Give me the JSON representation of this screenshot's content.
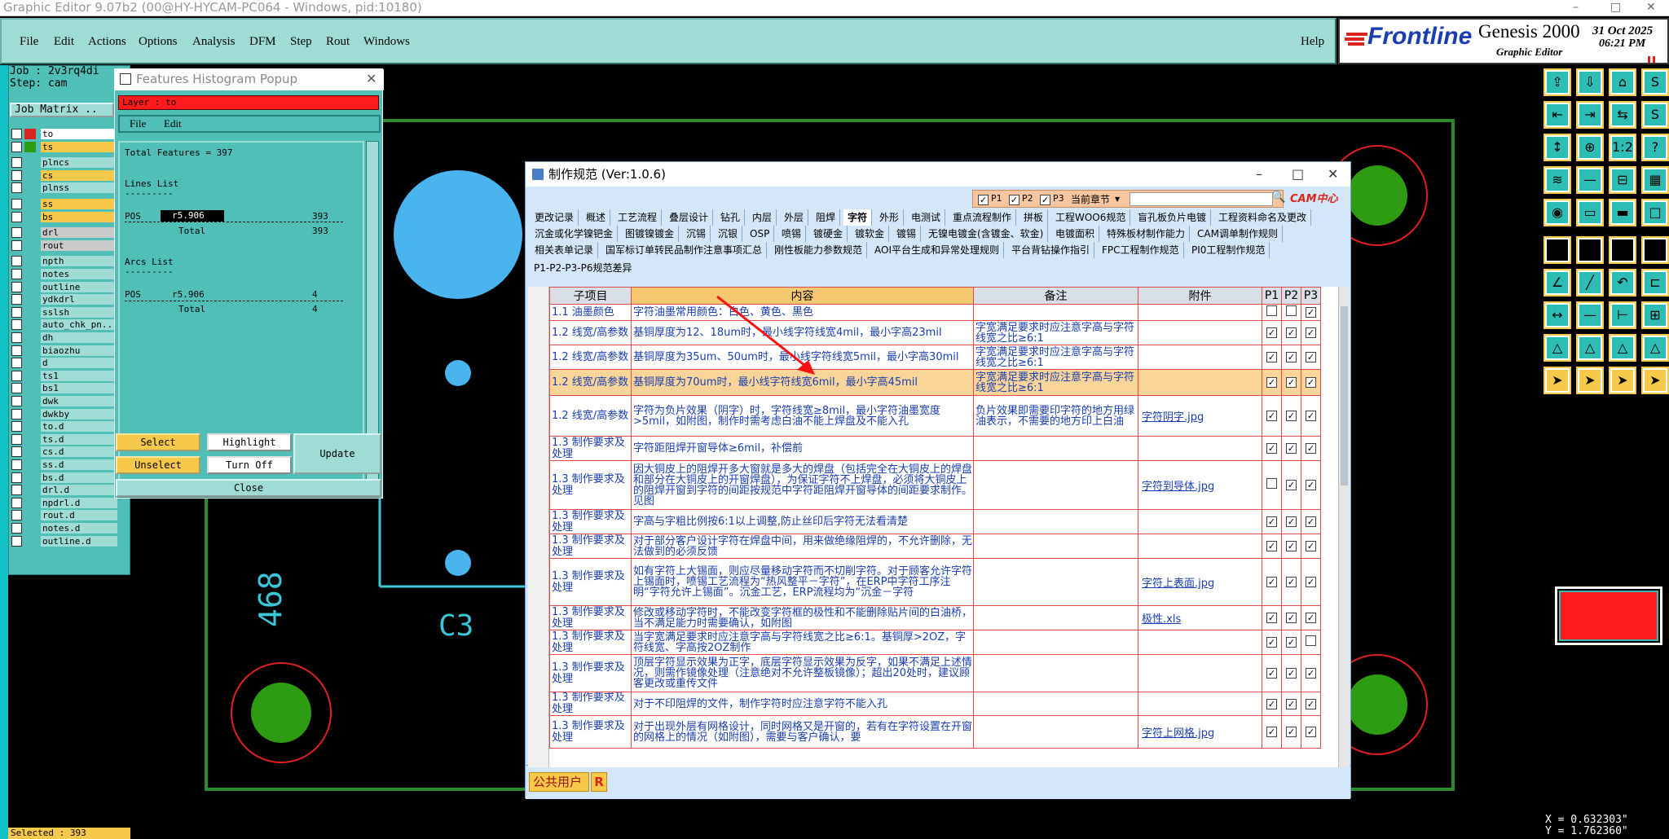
{
  "window": {
    "title": "Graphic Editor 9.07b2 (00@HY-HYCAM-PC064 - Windows, pid:10180)",
    "min": "–",
    "max": "□",
    "close": "✕"
  },
  "menu": {
    "file": "File",
    "edit": "Edit",
    "actions": "Actions",
    "options": "Options",
    "analysis": "Analysis",
    "dfm": "DFM",
    "step": "Step",
    "rout": "Rout",
    "windows": "Windows",
    "help": "Help"
  },
  "brand": {
    "logo": "Frontline",
    "product": "Genesis 2000",
    "subtitle": "Graphic Editor",
    "date": "31 Oct 2025",
    "time": "06:21 PM"
  },
  "job": {
    "job": "Job : 2v3rq4di",
    "step": "Step: cam",
    "matrix": "Job Matrix .."
  },
  "layers": [
    "to",
    "ts",
    "plncs",
    "cs",
    "plnss",
    "ss",
    "bs",
    "drl",
    "rout",
    "npth",
    "notes",
    "outline",
    "ydkdrl",
    "sslsh",
    "auto_chk_pn..",
    "dh",
    "biaozhu",
    "d",
    "ts1",
    "bs1",
    "dwk",
    "dwkby",
    "to.d",
    "ts.d",
    "cs.d",
    "ss.d",
    "bs.d",
    "drl.d",
    "npdrl.d",
    "rout.d",
    "notes.d",
    "outline.d"
  ],
  "selected": "Selected : 393",
  "histogram": {
    "title": "Features Histogram Popup",
    "layer": "Layer :  to",
    "file": "File",
    "edit": "Edit",
    "total": "Total Features = 397",
    "lines_title": "Lines List",
    "dash": "---------",
    "pos": "POS",
    "sym": "r5.906",
    "lines_count": "393",
    "total_lbl": "Total",
    "arcs_title": "Arcs List",
    "arcs_count": "4",
    "select": "Select",
    "highlight": "Highlight",
    "update": "Update",
    "unselect": "Unselect",
    "turnoff": "Turn Off",
    "close": "Close"
  },
  "board": {
    "label_c3": "C3",
    "label_468": "468"
  },
  "mk": {
    "title": "制作规范 (Ver:1.0.6)",
    "p1": "P1",
    "p2": "P2",
    "p3": "P3",
    "chapter": "当前章节",
    "logo": "CAM中心",
    "tabs_row1": [
      "更改记录",
      "概述",
      "工艺流程",
      "叠层设计",
      "钻孔",
      "内层",
      "外层",
      "阻焊",
      "字符",
      "外形",
      "电测试",
      "重点流程制作",
      "拼板",
      "工程WOO6规范",
      "盲孔板负片电镀",
      "工程资料命名及更改"
    ],
    "tabs_row2": [
      "沉金或化学镍钯金",
      "图镀镍镀金",
      "沉锡",
      "沉银",
      "OSP",
      "喷锡",
      "镀硬金",
      "镀软金",
      "镀锡",
      "无镍电镀金(含镀金、软金)",
      "电镀面积",
      "特殊板材制作能力",
      "CAM调单制作规则"
    ],
    "tabs_row3": [
      "相关表单记录",
      "国军标订单转民品制作注意事项汇总",
      "刚性板能力参数规范",
      "AOI平台生成和异常处理规则",
      "平台背钻操作指引",
      "FPC工程制作规范",
      "PI0工程制作规范"
    ],
    "tab_row4": "P1-P2-P3-P6规范差异",
    "cols": {
      "sub": "子项目",
      "content": "内容",
      "note": "备注",
      "attach": "附件",
      "p1": "P1",
      "p2": "P2",
      "p3": "P3"
    },
    "rows": [
      {
        "sub": "1.1 油墨颜色",
        "content": "字符油墨常用颜色：白色、黄色、黑色",
        "note": "",
        "att": "",
        "c": [
          false,
          false,
          true
        ]
      },
      {
        "sub": "1.2 线宽/高参数",
        "content": "基铜厚度为12、18um时，最小线字符线宽4mil，最小字高23mil",
        "note": "字宽满足要求时应注意字高与字符线宽之比≥6:1",
        "att": "",
        "c": [
          true,
          true,
          true
        ]
      },
      {
        "sub": "1.2 线宽/高参数",
        "content": "基铜厚度为35um、50um时，最小线字符线宽5mil，最小字高30mil",
        "note": "字宽满足要求时应注意字高与字符线宽之比≥6:1",
        "att": "",
        "c": [
          true,
          true,
          true
        ]
      },
      {
        "sub": "1.2 线宽/高参数",
        "content": "基铜厚度为70um时，最小线字符线宽6mil，最小字高45mil",
        "note": "字宽满足要求时应注意字高与字符线宽之比≥6:1",
        "att": "",
        "c": [
          true,
          true,
          true
        ]
      },
      {
        "sub": "1.2 线宽/高参数",
        "content": "字符为负片效果（阴字）时，字符线宽≥8mil，最小字符油墨宽度>5mil，如附图，制作时需考虑白油不能上焊盘及不能入孔",
        "note": "负片效果即需要印字符的地方用绿油表示，不需要的地方印上白油",
        "att": "字符阴字.jpg",
        "c": [
          true,
          true,
          true
        ]
      },
      {
        "sub": "1.3 制作要求及处理",
        "content": "字符距阻焊开窗导体≥6mil，补偿前",
        "note": "",
        "att": "",
        "c": [
          true,
          true,
          true
        ]
      },
      {
        "sub": "1.3 制作要求及处理",
        "content": "因大铜皮上的阻焊开多大窗就是多大的焊盘（包括完全在大铜皮上的焊盘和部分在大铜皮上的开窗焊盘），为保证字符不上焊盘，必须将大铜皮上的阻焊开窗到字符的间距按规范中字符距阻焊开窗导体的间距要求制作。 见图",
        "note": "",
        "att": "字符到导体.jpg",
        "c": [
          false,
          true,
          true
        ]
      },
      {
        "sub": "1.3 制作要求及处理",
        "content": "字高与字粗比例按6:1以上调整,防止丝印后字符无法看清楚",
        "note": "",
        "att": "",
        "c": [
          true,
          true,
          true
        ]
      },
      {
        "sub": "1.3 制作要求及处理",
        "content": "对于部分客户设计字符在焊盘中间，用来做绝缘阻焊的，不允许删除，无法做到的必须反馈",
        "note": "",
        "att": "",
        "c": [
          true,
          true,
          true
        ]
      },
      {
        "sub": "1.3 制作要求及处理",
        "content": "如有字符上大锡面，则应尽量移动字符而不切削字符。对于顾客允许字符上锡面时，喷锡工艺流程为“热风整平－字符”，在ERP中字符工序注明“字符允许上锡面”。沉金工艺，ERP流程均为“沉金－字符",
        "note": "",
        "att": "字符上表面.jpg",
        "c": [
          true,
          true,
          true
        ]
      },
      {
        "sub": "1.3 制作要求及处理",
        "content": "修改或移动字符时，不能改变字符框的极性和不能删除贴片间的白油桥，当不满足能力时需要确认，如附图",
        "note": "",
        "att": "极性.xls",
        "c": [
          true,
          true,
          true
        ]
      },
      {
        "sub": "1.3 制作要求及处理",
        "content": "当字宽满足要求时应注意字高与字符线宽之比≥6:1。基铜厚>2OZ，字符线宽、字高按2OZ制作",
        "note": "",
        "att": "",
        "c": [
          true,
          true,
          false
        ]
      },
      {
        "sub": "1.3 制作要求及处理",
        "content": "顶层字符显示效果为正字，底层字符显示效果为反字，如果不满足上述情况，则需作镜像处理（注意绝对不允许整板镜像）；超出20处时，建议顾客更改或重传文件",
        "note": "",
        "att": "",
        "c": [
          true,
          true,
          true
        ]
      },
      {
        "sub": "1.3 制作要求及处理",
        "content": "对于不印阻焊的文件，制作字符时应注意字符不能入孔",
        "note": "",
        "att": "",
        "c": [
          true,
          true,
          true
        ]
      },
      {
        "sub": "1.3 制作要求及处理",
        "content": "对于出现外层有网格设计，同时网格又是开窗的，若有在字符设置在开窗的网格上的情况（如附图），需要与客户确认，要",
        "note": "",
        "att": "字符上网格.jpg",
        "c": [
          true,
          true,
          true
        ]
      }
    ],
    "user": "公共用户",
    "r": "R"
  },
  "coords": {
    "x": "X = 0.632303\"",
    "y": "Y = 1.762360\""
  },
  "colors": {
    "teal": "#4fbfb7",
    "lightTeal": "#a0dcd6",
    "yellow": "#f6c94a",
    "red": "#ff1b1b",
    "copperGreen": "#2e9c12",
    "padBlue": "#4ab4ef",
    "outlineGreen": "#2e8a2e"
  }
}
